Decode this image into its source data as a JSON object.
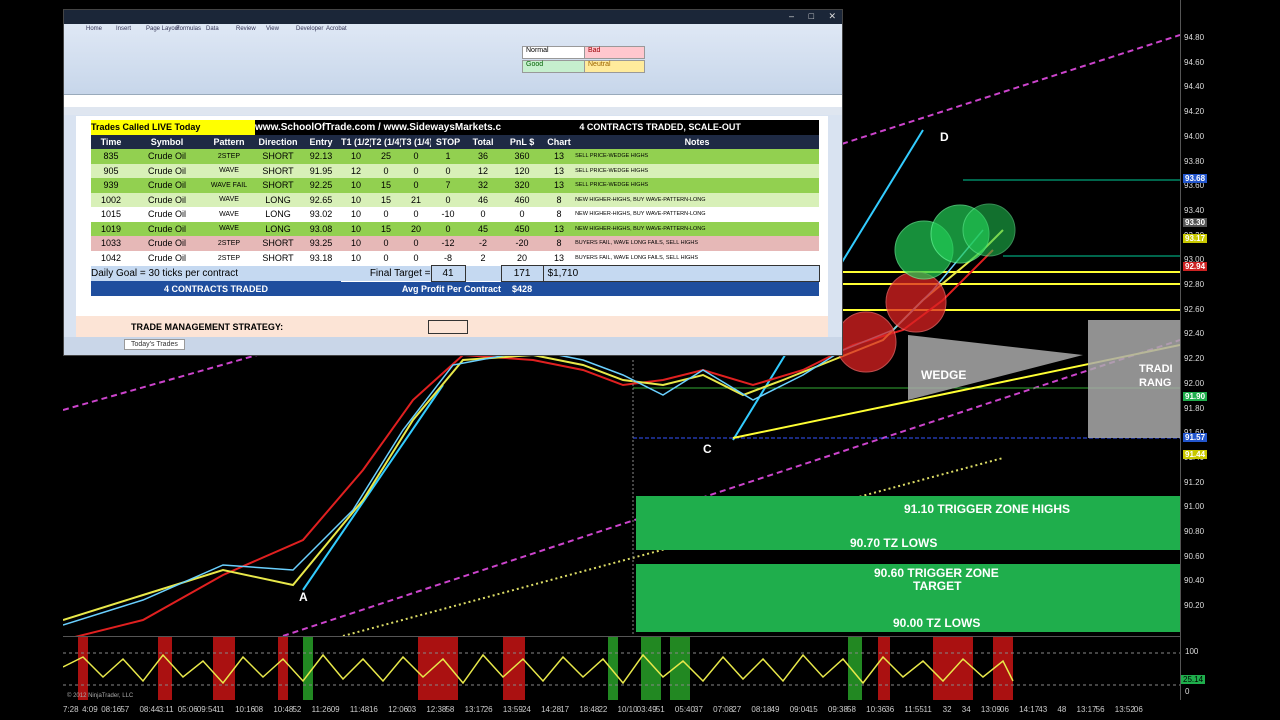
{
  "excel": {
    "sheet_tab": "Today's Trades",
    "tabs": [
      "Home",
      "Insert",
      "Page Layout",
      "Formulas",
      "Data",
      "Review",
      "View",
      "Developer",
      "Acrobat"
    ],
    "styles": {
      "normal": "Normal",
      "bad": "Bad",
      "good": "Good",
      "neutral": "Neutral"
    },
    "header_left": "Trades Called LIVE Today",
    "header_mid": "www.SchoolOfTrade.com / www.SidewaysMarkets.com",
    "header_right": "4 CONTRACTS TRADED, SCALE-OUT",
    "columns": [
      "Time",
      "Symbol",
      "Pattern",
      "Direction",
      "Entry",
      "T1 (1/2)",
      "T2 (1/4)",
      "T3 (1/4)",
      "STOP",
      "Total",
      "PnL $",
      "Chart",
      "Notes"
    ],
    "rows": [
      {
        "time": "835",
        "symbol": "Crude Oil",
        "pattern": "2STEP",
        "direction": "SHORT",
        "entry": "92.13",
        "t1": "10",
        "t2": "25",
        "t3": "0",
        "stop": "1",
        "total": "36",
        "pnl": "360",
        "chart": "13",
        "notes": "SELL PRICE-WEDGE HIGHS",
        "style": "rg"
      },
      {
        "time": "905",
        "symbol": "Crude Oil",
        "pattern": "WAVE",
        "direction": "SHORT",
        "entry": "91.95",
        "t1": "12",
        "t2": "0",
        "t3": "0",
        "stop": "0",
        "total": "12",
        "pnl": "120",
        "chart": "13",
        "notes": "SELL PRICE-WEDGE HIGHS",
        "style": "rl"
      },
      {
        "time": "939",
        "symbol": "Crude Oil",
        "pattern": "WAVE FAIL",
        "direction": "SHORT",
        "entry": "92.25",
        "t1": "10",
        "t2": "15",
        "t3": "0",
        "stop": "7",
        "total": "32",
        "pnl": "320",
        "chart": "13",
        "notes": "SELL PRICE-WEDGE HIGHS",
        "style": "rg"
      },
      {
        "time": "1002",
        "symbol": "Crude Oil",
        "pattern": "WAVE",
        "direction": "LONG",
        "entry": "92.65",
        "t1": "10",
        "t2": "15",
        "t3": "21",
        "stop": "0",
        "total": "46",
        "pnl": "460",
        "chart": "8",
        "notes": "NEW HIGHER-HIGHS, BUY WAVE-PATTERN-LONG",
        "style": "rl"
      },
      {
        "time": "1015",
        "symbol": "Crude Oil",
        "pattern": "WAVE",
        "direction": "LONG",
        "entry": "93.02",
        "t1": "10",
        "t2": "0",
        "t3": "0",
        "stop": "-10",
        "total": "0",
        "pnl": "0",
        "chart": "8",
        "notes": "NEW HIGHER-HIGHS, BUY WAVE-PATTERN-LONG",
        "style": "rw"
      },
      {
        "time": "1019",
        "symbol": "Crude Oil",
        "pattern": "WAVE",
        "direction": "LONG",
        "entry": "93.08",
        "t1": "10",
        "t2": "15",
        "t3": "20",
        "stop": "0",
        "total": "45",
        "pnl": "450",
        "chart": "13",
        "notes": "NEW HIGHER-HIGHS, BUY WAVE-PATTERN-LONG",
        "style": "rg"
      },
      {
        "time": "1033",
        "symbol": "Crude Oil",
        "pattern": "2STEP",
        "direction": "SHORT",
        "entry": "93.25",
        "t1": "10",
        "t2": "0",
        "t3": "0",
        "stop": "-12",
        "total": "-2",
        "pnl": "-20",
        "chart": "8",
        "notes": "BUYERS FAIL, WAVE LONG FAILS, SELL HIGHS",
        "style": "rr"
      },
      {
        "time": "1042",
        "symbol": "Crude Oil",
        "pattern": "2STEP",
        "direction": "SHORT",
        "entry": "93.18",
        "t1": "10",
        "t2": "0",
        "t3": "0",
        "stop": "-8",
        "total": "2",
        "pnl": "20",
        "chart": "13",
        "notes": "BUYERS FAIL, WAVE LONG FAILS, SELL HIGHS",
        "style": "rw"
      }
    ],
    "goal_text": "Daily Goal = 30 ticks per contract",
    "final_target_label": "Final Target =",
    "final_target": "41",
    "total_ticks": "171",
    "total_pnl": "$1,710",
    "contracts_label": "4 CONTRACTS TRADED",
    "avg_label": "Avg Profit Per Contract",
    "avg_value": "$428",
    "strategy_label": "TRADE MANAGEMENT STRATEGY:"
  },
  "chart": {
    "labels": {
      "a": "A",
      "c": "C",
      "d": "D",
      "wedge": "WEDGE",
      "trading_range": "TRADI\nRANG"
    },
    "zones": {
      "z1_top": "91.10 TRIGGER ZONE HIGHS",
      "z1_bottom": "90.70 TZ LOWS",
      "z2_top": "90.60 TRIGGER ZONE",
      "z2_sub": "TARGET",
      "z2_bottom": "90.00 TZ LOWS"
    },
    "price_ticks": [
      "94.80",
      "94.60",
      "94.40",
      "94.20",
      "94.00",
      "93.80",
      "93.60",
      "93.40",
      "93.20",
      "93.00",
      "92.80",
      "92.60",
      "92.40",
      "92.20",
      "92.00",
      "91.80",
      "91.60",
      "91.40",
      "91.20",
      "91.00",
      "90.80",
      "90.60",
      "90.40",
      "90.20"
    ],
    "price_tags": [
      {
        "text": "93.68",
        "color": "#2255cc"
      },
      {
        "text": "93.30",
        "color": "#555555"
      },
      {
        "text": "93.17",
        "color": "#c8c800"
      },
      {
        "text": "92.94",
        "color": "#cc2222"
      },
      {
        "text": "91.90",
        "color": "#1fae4c"
      },
      {
        "text": "91.57",
        "color": "#2255cc"
      },
      {
        "text": "91.44",
        "color": "#c8c800"
      }
    ],
    "osc_ticks": [
      "100",
      "0"
    ],
    "osc_tag": "25.14",
    "times": [
      "7:28",
      "4:09",
      "08:16",
      "57",
      "08:44",
      "3:11",
      "05:06",
      "09:54",
      "11",
      "10:16",
      "08",
      "10:48",
      "52",
      "11:26",
      "09",
      "11:48",
      "16",
      "12:06",
      "03",
      "12:38",
      "58",
      "13:17",
      "26",
      "13:59",
      "24",
      "14:28",
      "17",
      "18:48",
      "22",
      "10/10",
      "03:49",
      "51",
      "05:40",
      "37",
      "07:08",
      "27",
      "08:18",
      "49",
      "09:04",
      "15",
      "09:38",
      "58",
      "10:36",
      "36",
      "11:55",
      "11",
      "32",
      "34",
      "13:09",
      "06",
      "14:17",
      "43",
      "48",
      "13:17",
      "56",
      "13:52",
      "06"
    ],
    "copyright": "© 2012 NinjaTrader, LLC"
  }
}
